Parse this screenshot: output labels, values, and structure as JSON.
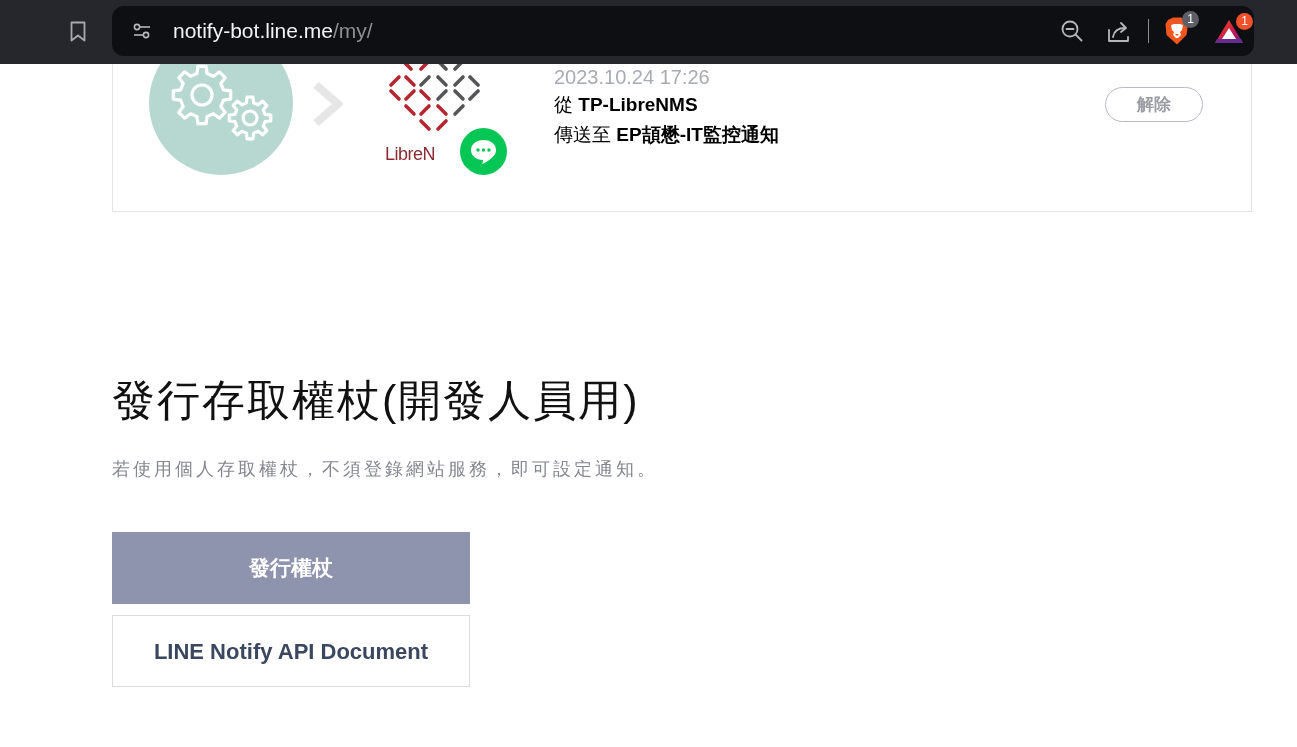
{
  "browser": {
    "url_host": "notify-bot.line.me",
    "url_path": "/my/",
    "extensions": [
      {
        "kind": "shields",
        "badge": "1"
      },
      {
        "kind": "rewards",
        "badge": "1"
      }
    ]
  },
  "connections": [
    {
      "logo_text": "LibreN",
      "date": "2023.10.24 17:26",
      "from_line": "從 **TP-LibreNMS**",
      "to_line": "傳送至 **EP頡懋-IT監控通知**",
      "button": "解除"
    }
  ],
  "token_section": {
    "title": "發行存取權杖(開發人員用)",
    "description": "若使用個人存取權杖，不須登錄網站服務，即可設定通知。",
    "buttons": [
      {
        "label": "發行權杖",
        "kind": "primary"
      },
      {
        "label": "LINE Notify API Document",
        "kind": "outline"
      }
    ]
  }
}
